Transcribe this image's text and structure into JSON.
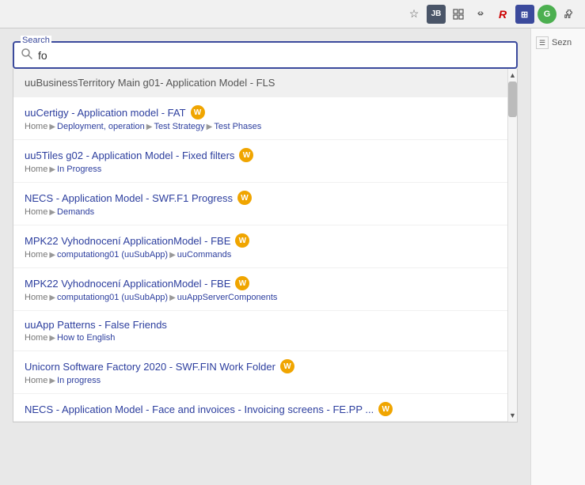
{
  "topbar": {
    "icons": [
      {
        "name": "star-icon",
        "symbol": "☆",
        "active": false
      },
      {
        "name": "jb-icon",
        "symbol": "JB",
        "active": false,
        "type": "jb"
      },
      {
        "name": "grid-icon",
        "symbol": "⊞",
        "active": false
      },
      {
        "name": "link-icon",
        "symbol": "🔗",
        "active": false
      },
      {
        "name": "r-icon",
        "symbol": "R",
        "active": false
      },
      {
        "name": "active-icon",
        "symbol": "🔷",
        "active": true
      },
      {
        "name": "green-icon",
        "symbol": "G",
        "active": false,
        "type": "green"
      },
      {
        "name": "puzzle-icon",
        "symbol": "⊕",
        "active": false
      }
    ]
  },
  "search": {
    "label": "Search",
    "placeholder": "fo",
    "value": "fo"
  },
  "results": [
    {
      "id": 1,
      "title": "uuBusinessTerritory Main g01- Application Model - FLS",
      "breadcrumb": [],
      "badge": null,
      "highlighted": true
    },
    {
      "id": 2,
      "title": "uuCertigy - Application model - FAT",
      "breadcrumb": [
        "Home",
        "Deployment, operation",
        "Test Strategy",
        "Test Phases"
      ],
      "badge": "W"
    },
    {
      "id": 3,
      "title": "uu5Tiles g02 - Application Model - Fixed filters",
      "breadcrumb": [
        "Home",
        "In Progress"
      ],
      "badge": "W"
    },
    {
      "id": 4,
      "title": "NECS - Application Model - SWF.F1 Progress",
      "breadcrumb": [
        "Home",
        "Demands"
      ],
      "badge": "W"
    },
    {
      "id": 5,
      "title": "MPK22 Vyhodnocení ApplicationModel - FBE",
      "breadcrumb": [
        "Home",
        "computationg01 (uuSubApp)",
        "uuCommands"
      ],
      "badge": "W"
    },
    {
      "id": 6,
      "title": "MPK22 Vyhodnocení ApplicationModel - FBE",
      "breadcrumb": [
        "Home",
        "computationg01 (uuSubApp)",
        "uuAppServerComponents"
      ],
      "badge": "W"
    },
    {
      "id": 7,
      "title": "uuApp Patterns - False Friends",
      "breadcrumb": [
        "Home",
        "How to English"
      ],
      "badge": null
    },
    {
      "id": 8,
      "title": "Unicorn Software Factory 2020 - SWF.FIN Work Folder",
      "breadcrumb": [
        "Home",
        "In progress"
      ],
      "badge": "W"
    },
    {
      "id": 9,
      "title": "NECS - Application Model - Face and invoices - Invoicing screens - FE.PP ...",
      "breadcrumb": [],
      "badge": "W",
      "partial": true
    }
  ],
  "rightpanel": {
    "icon": "☰",
    "label": "Sezn"
  }
}
